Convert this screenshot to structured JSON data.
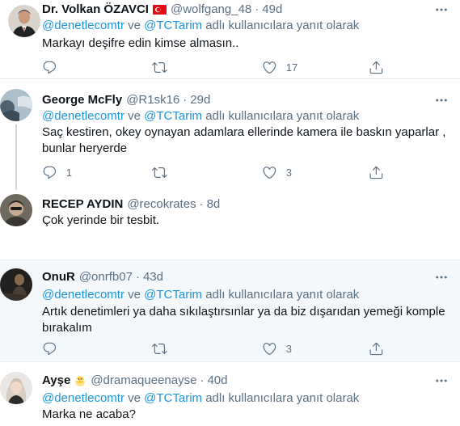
{
  "replying": {
    "mention1": "@denetlecomtr",
    "conj": "ve",
    "mention2": "@TCTarim",
    "suffix": "adlı kullanıcılara yanıt olarak"
  },
  "tweets": [
    {
      "name": "Dr. Volkan ÖZAVCI",
      "badge": "turkey-flag",
      "handle": "@wolfgang_48",
      "time": "49d",
      "show_reply_to": false,
      "text": "Markayı deşifre edin kimse almasın..",
      "reply_count": "",
      "retweet_count": "",
      "like_count": "17"
    },
    {
      "name": "George McFly",
      "handle": "@R1sk16",
      "time": "29d",
      "show_reply_to": true,
      "text": "Saç kestiren, okey oynayan adamlara ellerinde kamera ile baskın yaparlar , bunlar heryerde",
      "reply_count": "1",
      "retweet_count": "",
      "like_count": "3"
    },
    {
      "name": "RECEP AYDIN",
      "handle": "@recokrates",
      "time": "8d",
      "show_reply_to": false,
      "text": "Çok yerinde bir tesbit."
    },
    {
      "name": "OnuR",
      "handle": "@onrfb07",
      "time": "43d",
      "show_reply_to": true,
      "text": "Artık denetimleri ya daha sıkılaştırsınlar ya da biz dışarıdan yemeği komple bırakalım",
      "reply_count": "",
      "retweet_count": "",
      "like_count": "3"
    },
    {
      "name": "Ayşe",
      "badge": "chick-emoji",
      "handle": "@dramaqueenayse",
      "time": "40d",
      "show_reply_to": true,
      "text": "Marka ne acaba?"
    }
  ],
  "colors": {
    "link": "#1b95e0",
    "secondary_text": "#5b7083",
    "border": "#e6ecf0",
    "hover_bg": "#f5f8fa",
    "thread_line": "#ccd6dd"
  },
  "icons": [
    "reply-icon",
    "retweet-icon",
    "like-icon",
    "share-icon",
    "more-icon",
    "turkey-flag",
    "chick-emoji"
  ]
}
